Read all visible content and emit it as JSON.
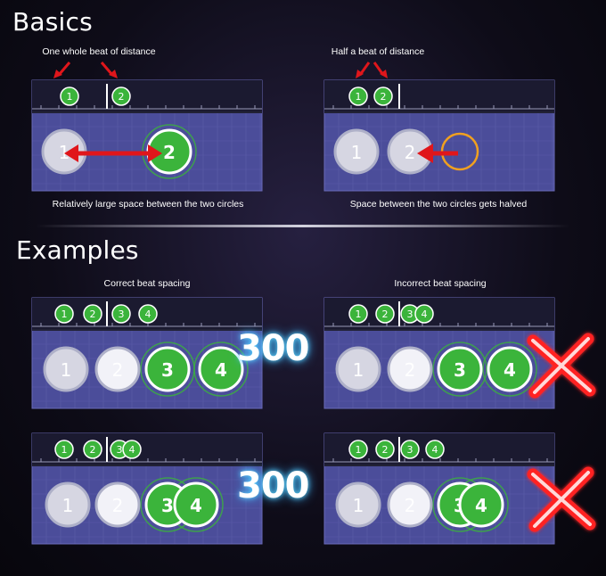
{
  "headings": {
    "basics": "Basics",
    "examples": "Examples"
  },
  "captions": {
    "one_beat": "One whole beat of distance",
    "half_beat": "Half a beat of distance",
    "large_space": "Relatively large space between the two circles",
    "halved_space": "Space between the two circles gets halved",
    "correct": "Correct beat spacing",
    "incorrect": "Incorrect beat spacing"
  },
  "score_value": "300",
  "colors": {
    "accent_green": "#3bb43b",
    "playfield": "#4b4d9a",
    "timeline": "#1b1a30",
    "arrow_red": "#e0161b",
    "approach_orange": "#f0a020",
    "score_glow": "#7fe8ff",
    "miss_red": "#ff2020"
  },
  "icons": {
    "arrow": "red-arrow-icon",
    "miss": "red-x-icon",
    "score": "score-300-text"
  },
  "panels": [
    {
      "id": "basics-whole",
      "timeline": [
        {
          "label": "1",
          "type": "note"
        },
        {
          "label": "2",
          "type": "note"
        }
      ],
      "circles": [
        {
          "label": "1",
          "state": "hit"
        },
        {
          "label": "2",
          "state": "active"
        }
      ],
      "overlay": "double-arrow"
    },
    {
      "id": "basics-half",
      "timeline": [
        {
          "label": "1",
          "type": "note"
        },
        {
          "label": "2",
          "type": "note"
        }
      ],
      "circles": [
        {
          "label": "1",
          "state": "hit"
        },
        {
          "label": "2",
          "state": "hit"
        }
      ],
      "overlay": "arrow-left"
    },
    {
      "id": "example-correct-1",
      "timeline": [
        {
          "label": "1"
        },
        {
          "label": "2"
        },
        {
          "label": "3"
        },
        {
          "label": "4"
        }
      ],
      "circles": [
        {
          "label": "1",
          "state": "hit"
        },
        {
          "label": "2",
          "state": "hit-bright"
        },
        {
          "label": "3",
          "state": "active"
        },
        {
          "label": "4",
          "state": "active"
        }
      ],
      "result": "300"
    },
    {
      "id": "example-incorrect-1",
      "timeline": [
        {
          "label": "1"
        },
        {
          "label": "2"
        },
        {
          "label": "3"
        },
        {
          "label": "4"
        }
      ],
      "circles": [
        {
          "label": "1",
          "state": "hit"
        },
        {
          "label": "2",
          "state": "hit-bright"
        },
        {
          "label": "3",
          "state": "active"
        },
        {
          "label": "4",
          "state": "active"
        }
      ],
      "result": "miss"
    },
    {
      "id": "example-correct-2",
      "timeline": [
        {
          "label": "1"
        },
        {
          "label": "2"
        },
        {
          "label": "3"
        },
        {
          "label": "4"
        }
      ],
      "circles": [
        {
          "label": "1",
          "state": "hit"
        },
        {
          "label": "2",
          "state": "hit-bright"
        },
        {
          "label": "3",
          "state": "active"
        },
        {
          "label": "4",
          "state": "active"
        }
      ],
      "result": "300"
    },
    {
      "id": "example-incorrect-2",
      "timeline": [
        {
          "label": "1"
        },
        {
          "label": "2"
        },
        {
          "label": "3"
        },
        {
          "label": "4"
        }
      ],
      "circles": [
        {
          "label": "1",
          "state": "hit"
        },
        {
          "label": "2",
          "state": "hit-bright"
        },
        {
          "label": "3",
          "state": "active"
        },
        {
          "label": "4",
          "state": "active"
        }
      ],
      "result": "miss"
    }
  ]
}
